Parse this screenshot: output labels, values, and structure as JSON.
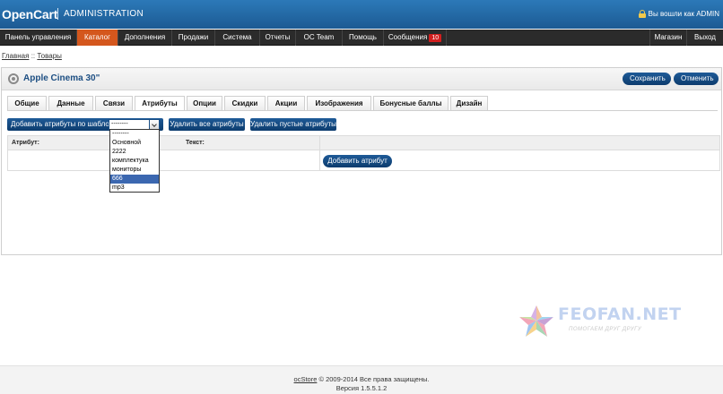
{
  "header": {
    "logo": "OpenCart",
    "logo_sub": "ADMINISTRATION",
    "login_text": "Вы вошли как ADMIN"
  },
  "menu": {
    "items": [
      {
        "label": "Панель управления"
      },
      {
        "label": "Каталог",
        "active": true
      },
      {
        "label": "Дополнения"
      },
      {
        "label": "Продажи"
      },
      {
        "label": "Система"
      },
      {
        "label": "Отчеты"
      },
      {
        "label": "OC Team"
      },
      {
        "label": "Помощь"
      },
      {
        "label": "Сообщения",
        "badge": "10"
      }
    ],
    "right_items": [
      {
        "label": "Магазин"
      },
      {
        "label": "Выход"
      }
    ]
  },
  "breadcrumb": {
    "home": "Главная",
    "separator": "::",
    "current": "Товары"
  },
  "panel": {
    "title": "Apple Cinema 30\"",
    "save_label": "Сохранить",
    "cancel_label": "Отменить"
  },
  "tabs": [
    {
      "label": "Общие"
    },
    {
      "label": "Данные"
    },
    {
      "label": "Связи"
    },
    {
      "label": "Атрибуты",
      "active": true
    },
    {
      "label": "Опции"
    },
    {
      "label": "Скидки"
    },
    {
      "label": "Акции"
    },
    {
      "label": "Изображения"
    },
    {
      "label": "Бонусные баллы"
    },
    {
      "label": "Дизайн"
    }
  ],
  "attributes": {
    "template_button": "Добавить атрибуты по шаблону:",
    "template_select_value": "--------",
    "template_options": [
      "--------",
      "Основной",
      "2222",
      "комплектука",
      "мониторы",
      "666",
      "mp3"
    ],
    "selected_option": "666",
    "delete_all_button": "Удалить все атрибуты",
    "delete_empty_button": "Удалить пустые атрибуты",
    "col_attribute": "Атрибут:",
    "col_text": "Текст:",
    "add_attribute_button": "Добавить атрибут"
  },
  "watermark": {
    "text": "FEOFAN.NET",
    "sub": "ПОМОГАЕМ ДРУГ ДРУГУ"
  },
  "footer": {
    "brand": "ocStore",
    "copyright": "© 2009-2014 Все права защищены.",
    "version": "Версия 1.5.5.1.2"
  },
  "colors": {
    "header": "#2068a8",
    "menu": "#2b2b2b",
    "menu_active": "#d4571d",
    "button": "#134a82",
    "selected_option": "#3b67b0"
  }
}
